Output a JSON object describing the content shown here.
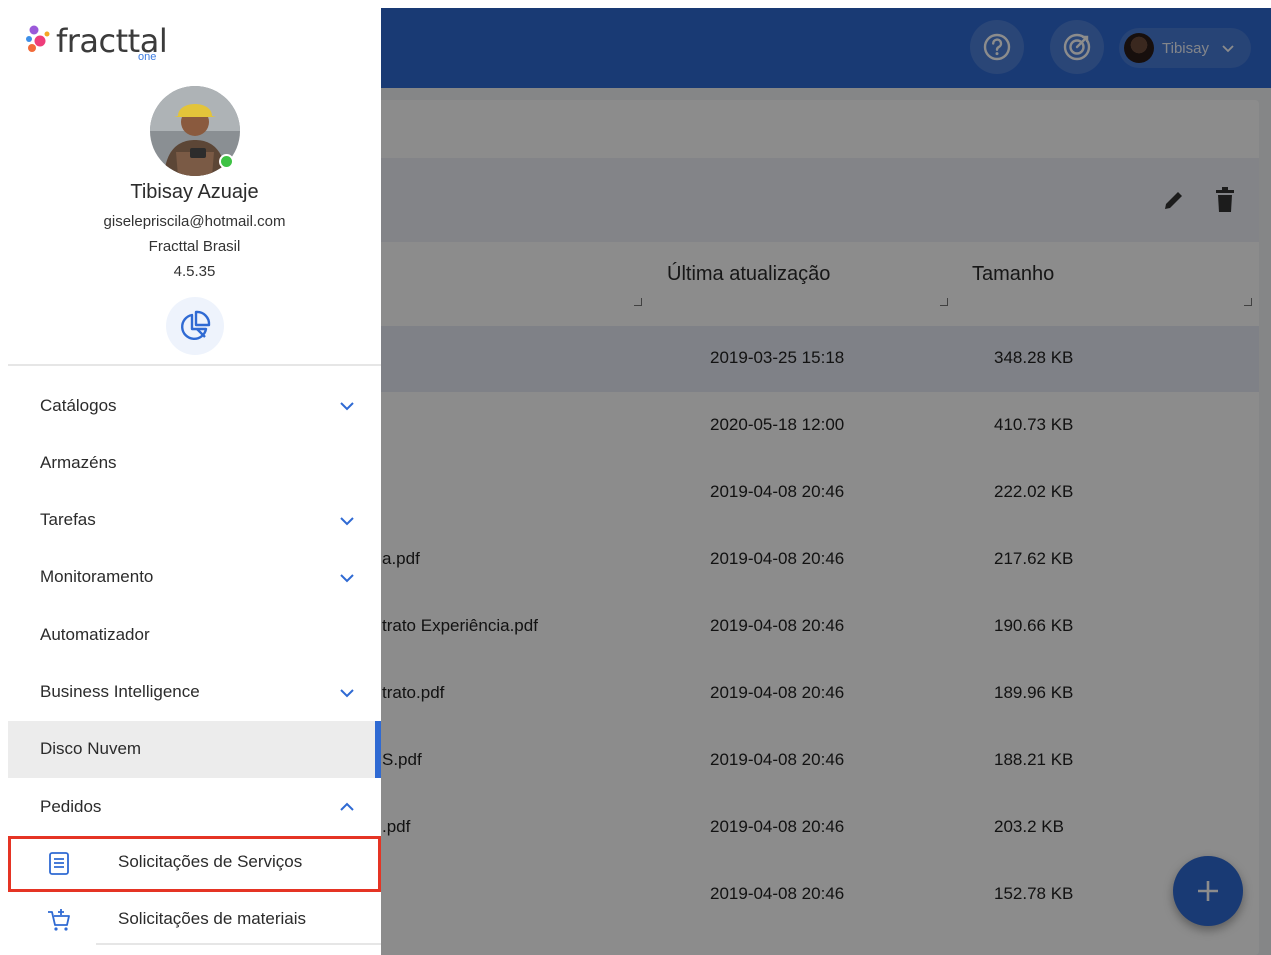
{
  "topbar": {
    "help_icon": "help-circle-icon",
    "whatsnew_icon": "target-icon",
    "user_name": "Tibisay",
    "accent": "#2f6ad3"
  },
  "table": {
    "headers": [
      "Última atualização",
      "Tamanho"
    ],
    "rows": [
      {
        "name": "",
        "updated": "2019-03-25 15:18",
        "size": "348.28 KB",
        "selected": true
      },
      {
        "name": "",
        "updated": "2020-05-18 12:00",
        "size": "410.73 KB"
      },
      {
        "name": "",
        "updated": "2019-04-08 20:46",
        "size": "222.02 KB"
      },
      {
        "name": "a.pdf",
        "updated": "2019-04-08 20:46",
        "size": "217.62 KB"
      },
      {
        "name": "trato Experiência.pdf",
        "updated": "2019-04-08 20:46",
        "size": "190.66 KB"
      },
      {
        "name": "trato.pdf",
        "updated": "2019-04-08 20:46",
        "size": "189.96 KB"
      },
      {
        "name": "S.pdf",
        "updated": "2019-04-08 20:46",
        "size": "188.21 KB"
      },
      {
        "name": ".pdf",
        "updated": "2019-04-08 20:46",
        "size": "203.2 KB"
      },
      {
        "name": "",
        "updated": "2019-04-08 20:46",
        "size": "152.78 KB"
      }
    ]
  },
  "drawer": {
    "logo_text": "fracttal",
    "logo_sub": "one",
    "profile": {
      "name": "Tibisay Azuaje",
      "email": "giselepriscila@hotmail.com",
      "company": "Fracttal Brasil",
      "version": "4.5.35"
    },
    "menu": [
      {
        "label": "Catálogos",
        "chevron": "down"
      },
      {
        "label": "Armazéns",
        "chevron": ""
      },
      {
        "label": "Tarefas",
        "chevron": "down"
      },
      {
        "label": "Monitoramento",
        "chevron": "down"
      },
      {
        "label": "Automatizador",
        "chevron": ""
      },
      {
        "label": "Business Intelligence",
        "chevron": "down"
      },
      {
        "label": "Disco Nuvem",
        "chevron": "",
        "active": true
      },
      {
        "label": "Pedidos",
        "chevron": "up"
      }
    ],
    "submenu": [
      {
        "label": "Solicitações de Serviços",
        "icon": "list-document-icon",
        "highlighted": true
      },
      {
        "label": "Solicitações de materiais",
        "icon": "cart-add-icon"
      }
    ]
  },
  "colors": {
    "highlight_border": "#e53424",
    "online": "#3ec244"
  }
}
